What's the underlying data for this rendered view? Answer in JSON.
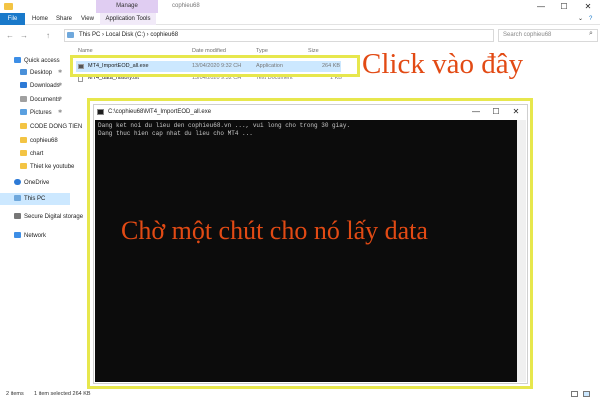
{
  "window": {
    "manage_tab": "Manage",
    "title": "cophieu68",
    "minimize": "—",
    "maximize": "☐",
    "close": "✕"
  },
  "ribbon": {
    "tabs": [
      "File",
      "Home",
      "Share",
      "View",
      "Application Tools"
    ],
    "help_chevron": "⌄",
    "help": "?"
  },
  "addressbar": {
    "path": "This PC  ›  Local Disk (C:)  ›  cophieu68",
    "search_placeholder": "Search cophieu68",
    "back": "←",
    "forward": "→",
    "up": "↑"
  },
  "nav": {
    "items": [
      {
        "label": "Quick access",
        "pinned": false
      },
      {
        "label": "Desktop",
        "pinned": true
      },
      {
        "label": "Downloads",
        "pinned": true
      },
      {
        "label": "Documents",
        "pinned": true
      },
      {
        "label": "Pictures",
        "pinned": true
      },
      {
        "label": "CODE DONG TIEN",
        "pinned": false
      },
      {
        "label": "cophieu68",
        "pinned": false
      },
      {
        "label": "chart",
        "pinned": false
      },
      {
        "label": "Thiet ke youtube",
        "pinned": false
      },
      {
        "label": "OneDrive",
        "pinned": false
      },
      {
        "label": "This PC",
        "pinned": false
      },
      {
        "label": "Secure Digital storage",
        "pinned": false
      },
      {
        "label": "Network",
        "pinned": false
      }
    ],
    "pin_glyph": "✱"
  },
  "filelist": {
    "columns": {
      "name": "Name",
      "date": "Date modified",
      "type": "Type",
      "size": "Size"
    },
    "rows": [
      {
        "name": "MT4_ImportEOD_all.exe",
        "date": "13/04/2020 9:32 CH",
        "type": "Application",
        "size": "264 KB"
      },
      {
        "name": "MT4_data_history.txt",
        "date": "13/04/2020 9:32 CH",
        "type": "Text Document",
        "size": "1 KB"
      }
    ]
  },
  "console": {
    "title": "C:\\cophieu68\\MT4_ImportEOD_all.exe",
    "lines": [
      "Dang ket noi du lieu den cophieu68.vn ..., vui long cho trong 30 giay.",
      "Dang thuc hien cap nhat du lieu cho MT4 ..."
    ]
  },
  "annotations": {
    "click_here": "Click vào đây",
    "wait": "Chờ một chút cho nó lấy data"
  },
  "statusbar": {
    "items_count": "2 items",
    "selected": "1 item selected  264 KB"
  },
  "colors": {
    "file_tab": "#1979ca",
    "manage_tab": "#e0cdf2",
    "highlight": "#e7e74d",
    "callout": "#e24a14",
    "console_bg": "#0c0c0c"
  }
}
